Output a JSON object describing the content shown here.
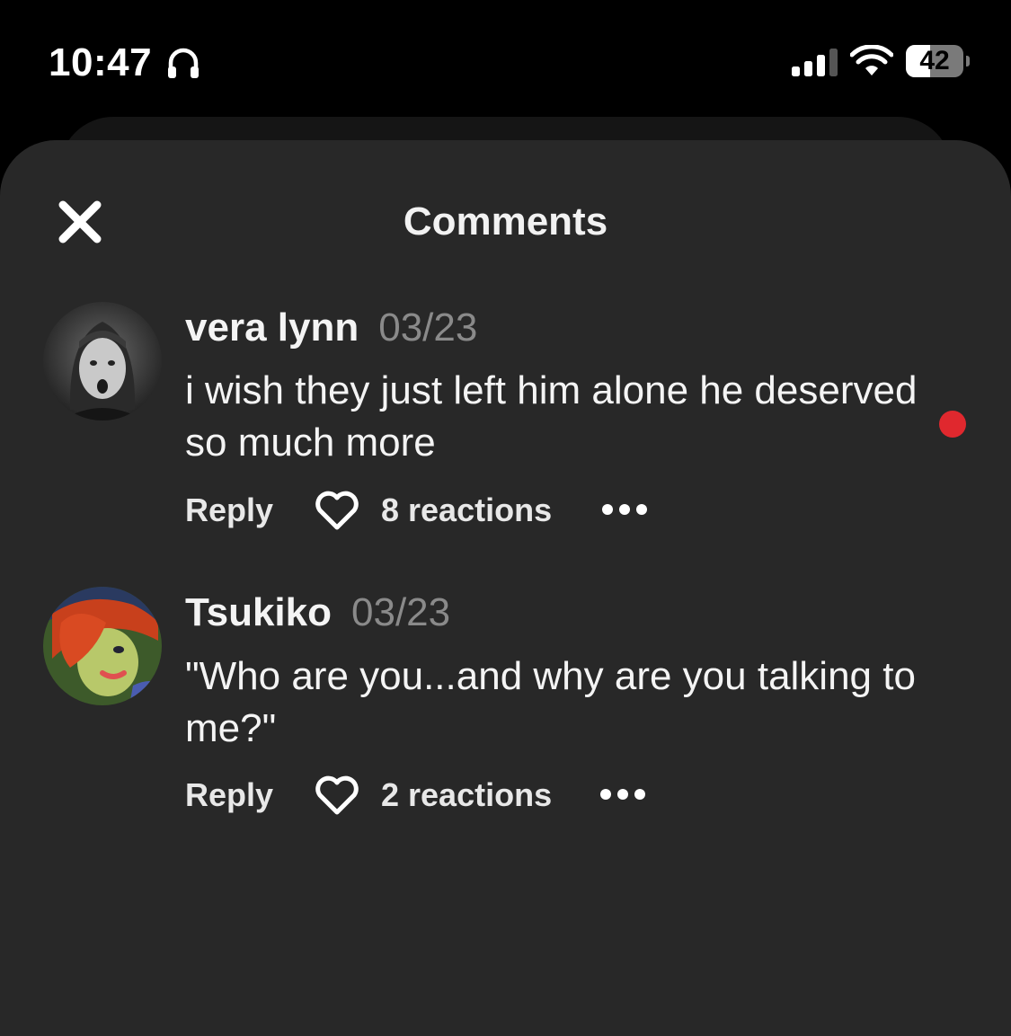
{
  "status_bar": {
    "time": "10:47",
    "battery_level": "42",
    "battery_fraction": 0.42,
    "icons": [
      "headphones-icon",
      "cellular-signal-icon",
      "wifi-icon",
      "battery-icon"
    ]
  },
  "sheet": {
    "title": "Comments",
    "close_icon": "close-icon"
  },
  "colors": {
    "sheet_bg": "#282828",
    "page_bg": "#000000",
    "unread_dot": "#e0282e",
    "date_text": "#8a8a8a"
  },
  "comments": [
    {
      "username": "vera lynn",
      "date": "03/23",
      "text": "i wish they just left him alone he deserved so much more",
      "reply_label": "Reply",
      "reactions": "8 reactions",
      "unread": true
    },
    {
      "username": "Tsukiko",
      "date": "03/23",
      "text": "\"Who are you...and why are you talking to me?\"",
      "reply_label": "Reply",
      "reactions": "2 reactions",
      "unread": false
    }
  ]
}
